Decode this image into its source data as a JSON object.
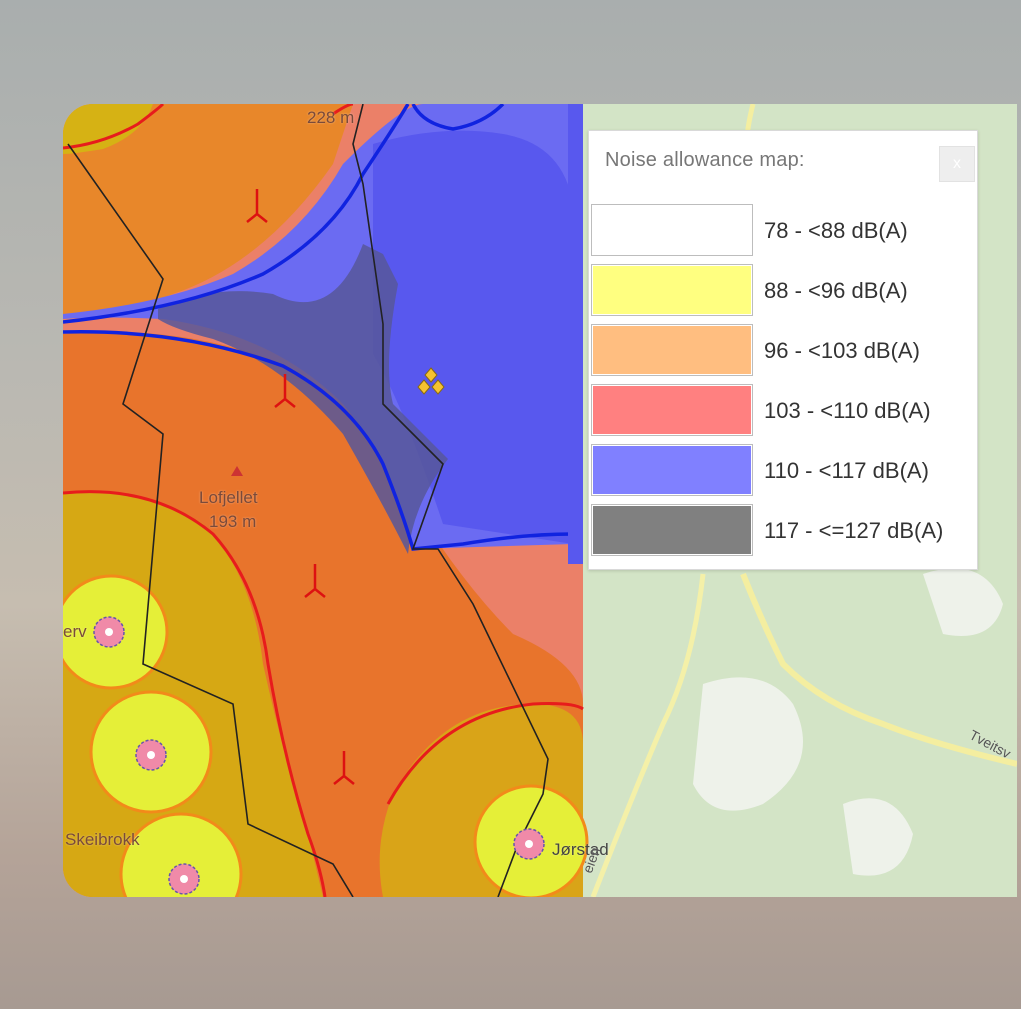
{
  "legend": {
    "title": "Noise allowance map:",
    "close_label": "x",
    "entries": [
      {
        "label": "78 - <88 dB(A)",
        "color": "#ffffff"
      },
      {
        "label": "88 - <96 dB(A)",
        "color": "#ffff80"
      },
      {
        "label": "96 - <103 dB(A)",
        "color": "#ffbe80"
      },
      {
        "label": "103 - <110 dB(A)",
        "color": "#ff8080"
      },
      {
        "label": "110 - <117 dB(A)",
        "color": "#8080ff"
      },
      {
        "label": "117 - <=127 dB(A)",
        "color": "#808080"
      }
    ]
  },
  "map": {
    "labels": {
      "peak_elevation_top": "228 m",
      "peak_name": "Lofjellet",
      "peak_elevation": "193 m",
      "place_skeibrokk": "Skeibrokk",
      "place_jorstad": "Jørstad",
      "place_erv": "erv",
      "road_tveits": "Tveitsv",
      "road_eien": "eien"
    },
    "icons": [
      "wind-turbine-icon",
      "peak-triangle-icon",
      "noise-receptor-icon",
      "diamond-cluster-icon"
    ]
  }
}
